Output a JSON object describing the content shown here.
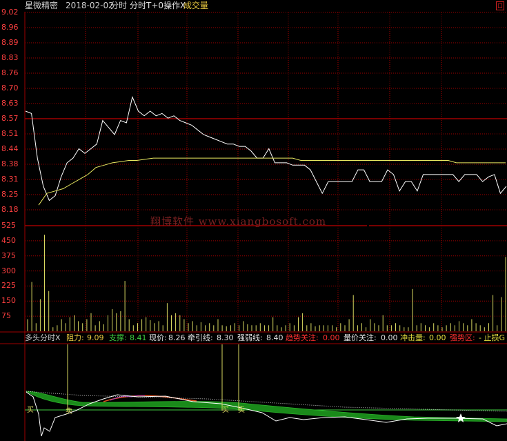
{
  "header": {
    "stock_name": "星微精密",
    "date": "2018-02-02",
    "mode": "分时",
    "indicator": "分时T+0操作X",
    "volume_label": "成交量",
    "close_glyph": "口"
  },
  "price_axis": [
    "9.02",
    "8.96",
    "8.89",
    "8.83",
    "8.76",
    "8.70",
    "8.63",
    "8.57",
    "8.51",
    "8.44",
    "8.38",
    "8.31",
    "8.25",
    "8.18"
  ],
  "volume_axis": [
    "525",
    "450",
    "375",
    "300",
    "225",
    "150",
    "75"
  ],
  "watermark": "翔博软件 www.xiangbosoft.com",
  "indicator_bar": {
    "name": "多头分时X",
    "resist_label": "阻力:",
    "resist_value": "9.09",
    "support_label": "支撑:",
    "support_value": "8.41",
    "price_label": "现价:",
    "price_value": "8.26",
    "pull_label": "牵引线:",
    "pull_value": "8.30",
    "strong_label": "强弱线:",
    "strong_value": "8.40",
    "trend_label": "趋势关注:",
    "trend_value": "0.00",
    "vp_label": "量价关注:",
    "vp_value": "0.00",
    "impact_label": "冲击量:",
    "impact_value": "0.00",
    "zone_label": "强势区:",
    "zone_value": "- 止损G"
  },
  "signals": {
    "buy": "买",
    "sell": "卖"
  },
  "colors": {
    "grid": "#a00000",
    "price_line": "#ffffff",
    "avg_line": "#e8e860",
    "volume_bar": "#d8d860",
    "band_fill": "#1a8a1a",
    "axis_text": "#ff4040",
    "zone_text": "#ff3030"
  },
  "chart_data": {
    "type": "line",
    "title": "",
    "xlabel": "",
    "ylabel": "",
    "ylim": [
      8.18,
      9.02
    ],
    "series": [
      {
        "values": [
          8.6,
          8.59,
          8.4,
          8.28,
          8.22,
          8.24,
          8.32,
          8.38,
          8.4,
          8.44,
          8.42,
          8.44,
          8.46,
          8.56,
          8.53,
          8.5,
          8.56,
          8.55,
          8.66,
          8.6,
          8.58,
          8.6,
          8.58,
          8.59,
          8.57,
          8.58,
          8.56,
          8.55,
          8.54,
          8.52,
          8.5,
          8.49,
          8.48,
          8.47,
          8.46,
          8.46,
          8.45,
          8.45,
          8.43,
          8.4,
          8.4,
          8.44,
          8.38,
          8.38,
          8.38,
          8.37,
          8.37,
          8.37,
          8.35,
          8.3,
          8.25,
          8.3,
          8.3,
          8.3,
          8.3,
          8.3,
          8.35,
          8.35,
          8.3,
          8.3,
          8.3,
          8.35,
          8.33,
          8.26,
          8.3,
          8.3,
          8.26,
          8.33,
          8.33,
          8.33,
          8.33,
          8.33,
          8.33,
          8.3,
          8.33,
          8.33,
          8.33,
          8.3,
          8.32,
          8.33,
          8.25,
          8.28
        ]
      },
      {
        "values": [
          8.2,
          8.25,
          8.26,
          8.27,
          8.29,
          8.31,
          8.33,
          8.36,
          8.37,
          8.38,
          8.385,
          8.39,
          8.39,
          8.395,
          8.4,
          8.4,
          8.4,
          8.4,
          8.4,
          8.4,
          8.4,
          8.4,
          8.4,
          8.4,
          8.4,
          8.4,
          8.4,
          8.4,
          8.4,
          8.4,
          8.4,
          8.4,
          8.39,
          8.39,
          8.39,
          8.39,
          8.39,
          8.39,
          8.39,
          8.39,
          8.39,
          8.39,
          8.39,
          8.39,
          8.39,
          8.39,
          8.39,
          8.39,
          8.39,
          8.39,
          8.39,
          8.38,
          8.38,
          8.38,
          8.38,
          8.38,
          8.38,
          8.38
        ]
      }
    ],
    "volume": {
      "ylim": [
        0,
        525
      ],
      "values": [
        60,
        245,
        40,
        160,
        480,
        200,
        20,
        30,
        60,
        40,
        70,
        80,
        50,
        40,
        60,
        90,
        30,
        50,
        35,
        80,
        110,
        90,
        100,
        250,
        60,
        30,
        40,
        60,
        70,
        55,
        40,
        50,
        30,
        140,
        80,
        90,
        80,
        60,
        40,
        50,
        30,
        45,
        30,
        40,
        30,
        60,
        30,
        25,
        30,
        40,
        30,
        50,
        35,
        30,
        30,
        40,
        30,
        30,
        70,
        30,
        20,
        30,
        40,
        30,
        70,
        90,
        30,
        40,
        25,
        30,
        30,
        30,
        30,
        20,
        40,
        30,
        60,
        180,
        30,
        40,
        20,
        60,
        40,
        30,
        80,
        30,
        30,
        40,
        30,
        20,
        20,
        210,
        30,
        40,
        30,
        20,
        40,
        30,
        20,
        30,
        40,
        30,
        50,
        40,
        30,
        60,
        40,
        30,
        20,
        40,
        180,
        30,
        170,
        370
      ]
    }
  }
}
